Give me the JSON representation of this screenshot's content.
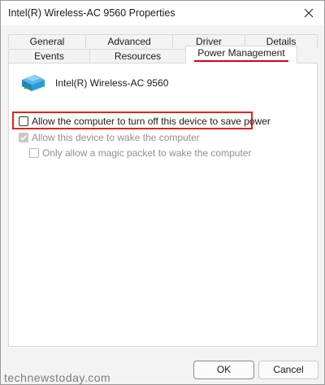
{
  "window": {
    "title": "Intel(R) Wireless-AC 9560 Properties"
  },
  "tabs_row1": [
    {
      "label": "General"
    },
    {
      "label": "Advanced"
    },
    {
      "label": "Driver"
    },
    {
      "label": "Details"
    }
  ],
  "tabs_row2": [
    {
      "label": "Events"
    },
    {
      "label": "Resources"
    },
    {
      "label": "Power Management",
      "active": true
    }
  ],
  "device": {
    "name": "Intel(R) Wireless-AC 9560",
    "icon": "network-adapter-icon"
  },
  "options": [
    {
      "label": "Allow the computer to turn off this device to save power",
      "checked": false,
      "enabled": true,
      "highlighted": true
    },
    {
      "label": "Allow this device to wake the computer",
      "checked": true,
      "enabled": false
    },
    {
      "label": "Only allow a magic packet to wake the computer",
      "checked": false,
      "enabled": false
    }
  ],
  "buttons": {
    "ok": "OK",
    "cancel": "Cancel"
  },
  "watermark": "technewstoday.com",
  "colors": {
    "highlight": "#e0241b",
    "active_tab_underline": "#d0021b"
  }
}
